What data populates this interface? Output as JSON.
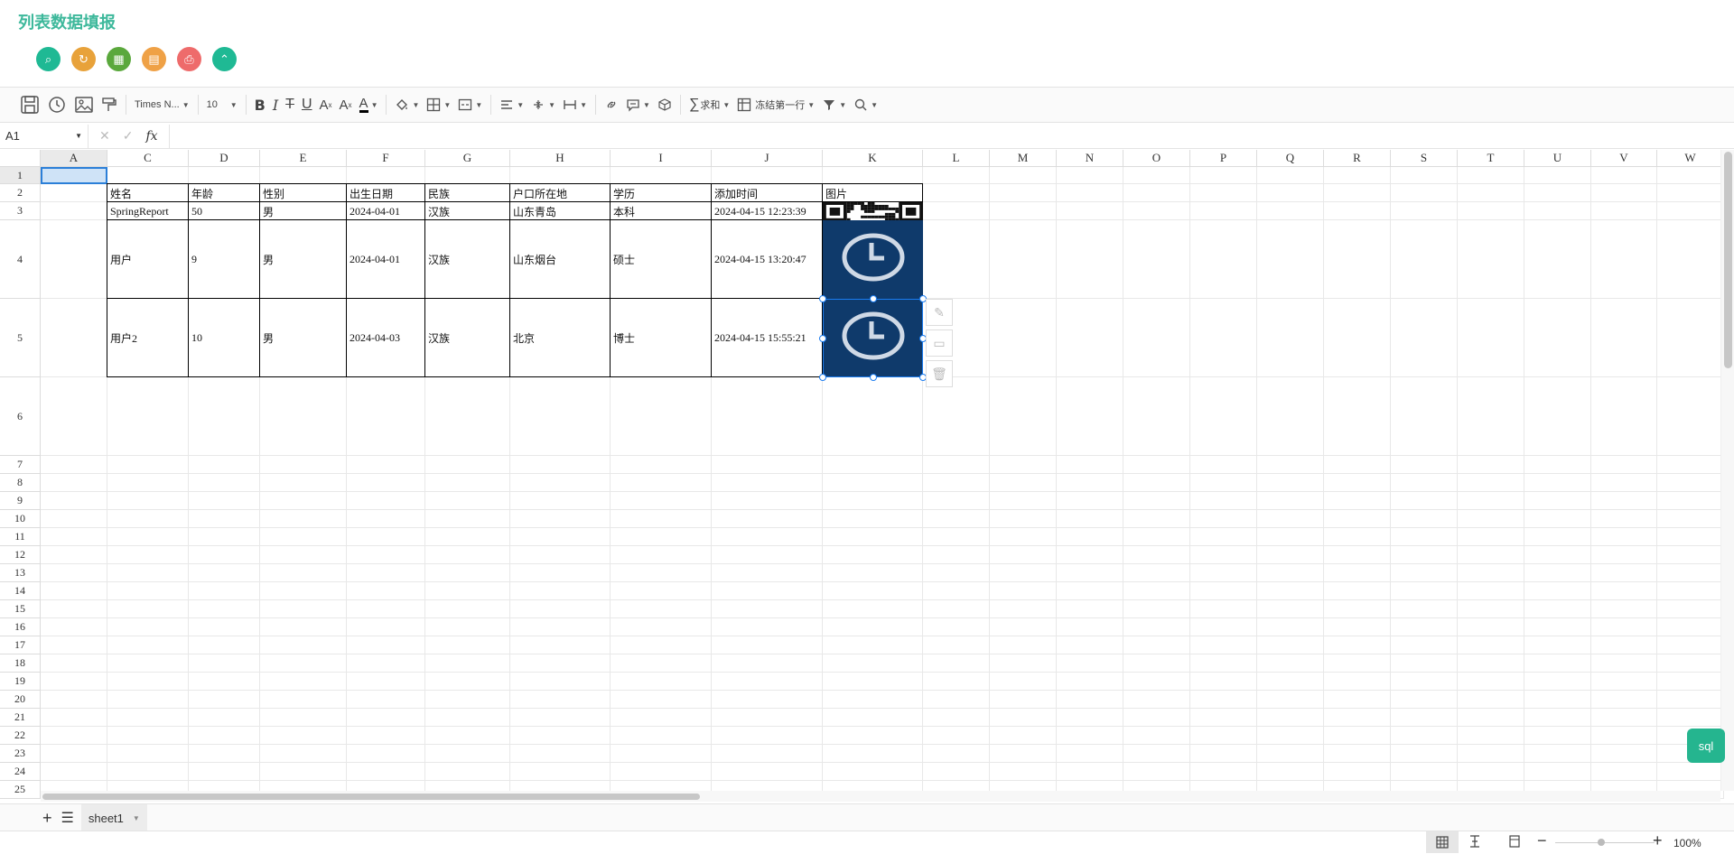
{
  "page": {
    "title": "列表数据填报"
  },
  "actions": [
    {
      "name": "search-button",
      "color": "#1fb994",
      "icon": "search-icon",
      "glyph": "⌕"
    },
    {
      "name": "reset-button",
      "color": "#e8a23a",
      "icon": "refresh-icon",
      "glyph": "↻"
    },
    {
      "name": "excel-button",
      "color": "#5aa83c",
      "icon": "excel-icon",
      "glyph": "▦"
    },
    {
      "name": "pdf-button",
      "color": "#efa146",
      "icon": "pdf-icon",
      "glyph": "▤"
    },
    {
      "name": "print-button",
      "color": "#ee6b6b",
      "icon": "print-icon",
      "glyph": "⎙"
    },
    {
      "name": "collapse-button",
      "color": "#1fb994",
      "icon": "chevron-up-icon",
      "glyph": "⌃"
    }
  ],
  "toolbar": {
    "font_family": "Times N...",
    "font_size": "10",
    "sum_label": "求和",
    "freeze_label": "冻结第一行"
  },
  "formula_bar": {
    "cell_ref": "A1",
    "fx": "fx",
    "value": ""
  },
  "columns": [
    "A",
    "C",
    "D",
    "E",
    "F",
    "G",
    "H",
    "I",
    "J",
    "K",
    "L",
    "M",
    "N",
    "O",
    "P",
    "Q",
    "R",
    "S",
    "T",
    "U",
    "V",
    "W"
  ],
  "rows": [
    "1",
    "2",
    "3",
    "4",
    "5",
    "6",
    "7",
    "8",
    "9",
    "10",
    "11",
    "12",
    "13",
    "14",
    "15",
    "16",
    "17",
    "18",
    "19",
    "20",
    "21",
    "22",
    "23",
    "24",
    "25"
  ],
  "table": {
    "headers": [
      "姓名",
      "年龄",
      "性别",
      "出生日期",
      "民族",
      "户口所在地",
      "学历",
      "添加时间",
      "图片"
    ],
    "records": [
      [
        "SpringReport",
        "50",
        "男",
        "2024-04-01",
        "汉族",
        "山东青岛",
        "本科",
        "2024-04-15 12:23:39"
      ],
      [
        "用户",
        "9",
        "男",
        "2024-04-01",
        "汉族",
        "山东烟台",
        "硕士",
        "2024-04-15 13:20:47"
      ],
      [
        "用户2",
        "10",
        "男",
        "2024-04-03",
        "汉族",
        "北京",
        "博士",
        "2024-04-15 15:55:21"
      ]
    ]
  },
  "sql_button": "sql",
  "sheets": [
    {
      "name": "sheet1"
    }
  ],
  "status": {
    "zoom": "100%"
  }
}
